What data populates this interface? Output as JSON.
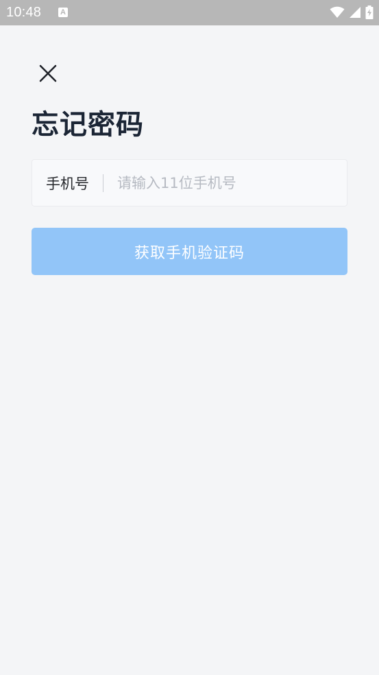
{
  "status_bar": {
    "time": "10:48",
    "notification_icon_letter": "A",
    "icons": [
      "wifi-icon",
      "signal-icon",
      "battery-charging-icon"
    ]
  },
  "header": {
    "close_icon": "close-icon",
    "title": "忘记密码"
  },
  "form": {
    "phone_label": "手机号",
    "phone_value": "",
    "phone_placeholder": "请输入11位手机号",
    "submit_label": "获取手机验证码"
  },
  "colors": {
    "status_bar_bg": "#b7b7b7",
    "page_bg": "#f4f5f7",
    "title_text": "#1b2535",
    "placeholder_text": "#b6bac2",
    "button_bg_disabled": "#92c5f8",
    "button_text": "#ffffff"
  }
}
